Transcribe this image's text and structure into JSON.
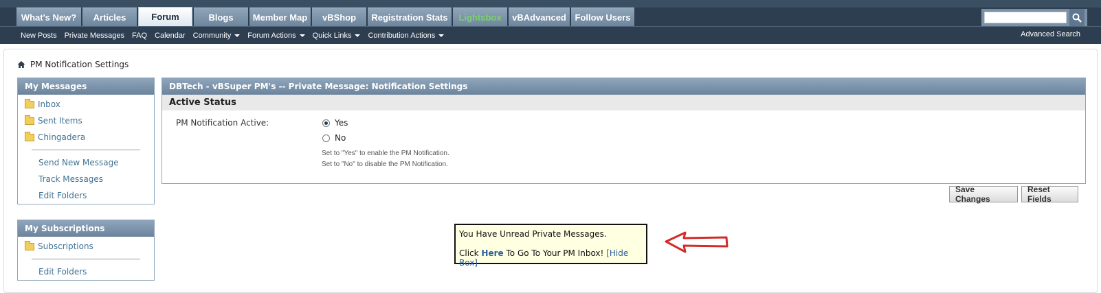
{
  "nav": {
    "tabs": [
      "What's New?",
      "Articles",
      "Forum",
      "Blogs",
      "Member Map",
      "vBShop",
      "Registration Stats",
      "Lightsbox",
      "vBAdvanced",
      "Follow Users"
    ],
    "active_tab": "Forum",
    "search_placeholder": ""
  },
  "subnav": {
    "items": [
      "New Posts",
      "Private Messages",
      "FAQ",
      "Calendar",
      "Community",
      "Forum Actions",
      "Quick Links",
      "Contribution Actions"
    ],
    "advanced_search": "Advanced Search"
  },
  "breadcrumb": {
    "title": "PM Notification Settings"
  },
  "my_messages": {
    "title": "My Messages",
    "folders": [
      "Inbox",
      "Sent Items",
      "Chingadera"
    ],
    "links": [
      "Send New Message",
      "Track Messages",
      "Edit Folders"
    ]
  },
  "my_subscriptions": {
    "title": "My Subscriptions",
    "folders": [
      "Subscriptions"
    ],
    "links": [
      "Edit Folders"
    ]
  },
  "settings": {
    "title": "DBTech - vBSuper PM's -- Private Message: Notification Settings",
    "section": "Active Status",
    "field_label": "PM Notification Active:",
    "options": [
      "Yes",
      "No"
    ],
    "selected": "Yes",
    "help": [
      "Set to \"Yes\" to enable the PM Notification.",
      "Set to \"No\" to disable the PM Notification."
    ]
  },
  "buttons": {
    "save": "Save Changes",
    "reset": "Reset Fields"
  },
  "notice": {
    "line1": "You Have Unread Private Messages.",
    "click": "Click",
    "here": "Here",
    "rest": "To Go To Your PM Inbox!",
    "hide": "[Hide Box]"
  },
  "colors": {
    "nav_bg": "#2d3e50",
    "header_blue": "#6b849c",
    "link": "#417394",
    "notice_bg": "#ffffe1",
    "arrow": "#d42a2a"
  }
}
